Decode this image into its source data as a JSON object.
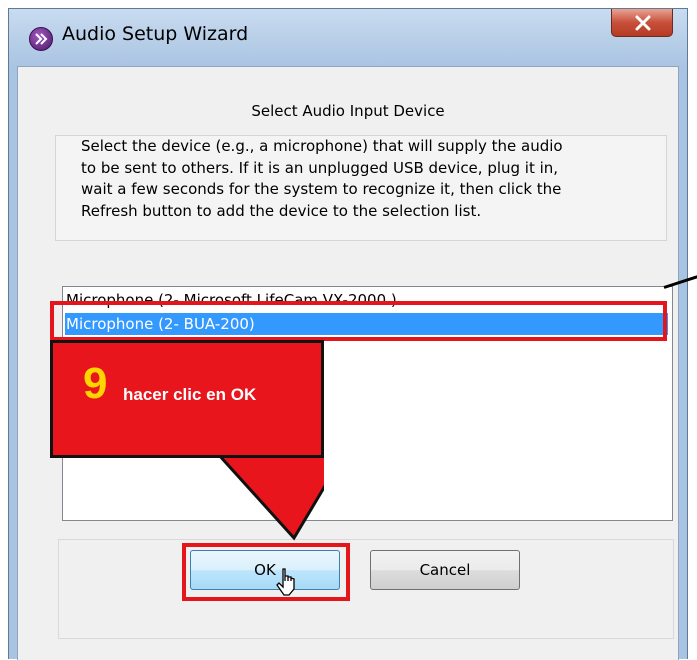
{
  "window": {
    "title": "Audio Setup Wizard",
    "close_icon": "close-icon"
  },
  "dialog": {
    "heading": "Select Audio Input Device",
    "description_lines": [
      "Select the device (e.g., a microphone) that will supply the audio",
      "to be sent to others. If it is an unplugged USB device, plug it in,",
      "wait a few seconds for the system to recognize it, then click the",
      "Refresh button to add the device to the selection list."
    ],
    "devices": [
      "Microphone (2- Microsoft LifeCam VX-2000.)",
      "Microphone (2- BUA-200)"
    ],
    "selected_device": "Microphone (2- BUA-200)",
    "ok_label": "OK",
    "cancel_label": "Cancel"
  },
  "annotation": {
    "step_number": "9",
    "step_text": "hacer clic en OK",
    "highlight_color": "#e4161c",
    "callout_color": "#e8161c"
  },
  "colors": {
    "selection": "#3399ff",
    "close_button": "#c7503a"
  }
}
